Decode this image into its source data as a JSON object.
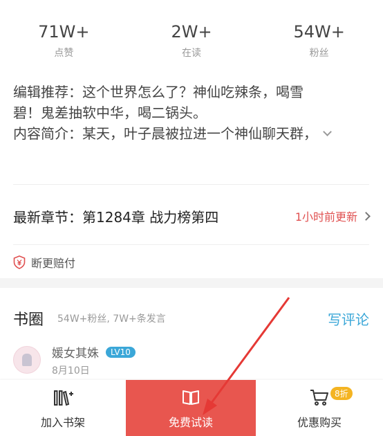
{
  "stats": [
    {
      "value": "71W+",
      "label": "点赞"
    },
    {
      "value": "2W+",
      "label": "在读"
    },
    {
      "value": "54W+",
      "label": "粉丝"
    }
  ],
  "description": {
    "line1": "编辑推荐：这个世界怎么了？神仙吃辣条，喝雪",
    "line2": "碧！鬼差抽软中华，喝二锅头。",
    "line3": "内容简介：某天，叶子晨被拉进一个神仙聊天群，"
  },
  "chapter": {
    "title": "最新章节：第1284章 战力榜第四",
    "update": "1小时前更新"
  },
  "guarantee": {
    "label": "断更赔付",
    "icon": "shield-yen-icon"
  },
  "circle": {
    "title": "书圈",
    "subtitle": "54W+粉丝, 7W+条发言",
    "write_comment": "写评论"
  },
  "user": {
    "name": "媛女其姝",
    "level": "LV10",
    "date": "8月10日"
  },
  "bottom_bar": {
    "add_shelf": "加入书架",
    "free_read": "免费试读",
    "buy": "优惠购买",
    "discount": "8折"
  },
  "colors": {
    "accent_red": "#e8564f",
    "link_blue": "#3ba7d8",
    "update_red": "#e05050",
    "discount_yellow": "#f4b422"
  }
}
